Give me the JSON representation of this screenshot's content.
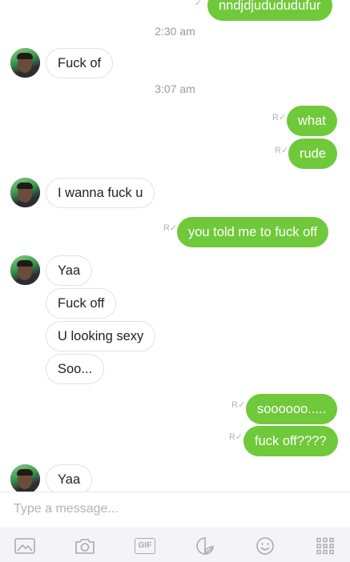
{
  "messages": {
    "m0": "nndjdjudududufur",
    "t1": "2:30 am",
    "m1": "Fuck of",
    "t2": "3:07 am",
    "m2": "what",
    "m3": "rude",
    "m4": "I wanna fuck u",
    "m5": "you told me to fuck off",
    "m6": "Yaa",
    "m7": "Fuck off",
    "m8": "U looking sexy",
    "m9": "Soo...",
    "m10": "soooooo.....",
    "m11": "fuck off????",
    "m12": "Yaa"
  },
  "composer": {
    "placeholder": "Type a message..."
  },
  "toolbar": {
    "gif_label": "GIF",
    "icons": [
      "image-icon",
      "camera-icon",
      "gif-icon",
      "sticker-icon",
      "emoji-icon",
      "apps-grid-icon"
    ]
  },
  "colors": {
    "outgoing": "#6fc93a",
    "incoming_border": "#e1e1e1",
    "timestamp": "#9a9a9a"
  }
}
